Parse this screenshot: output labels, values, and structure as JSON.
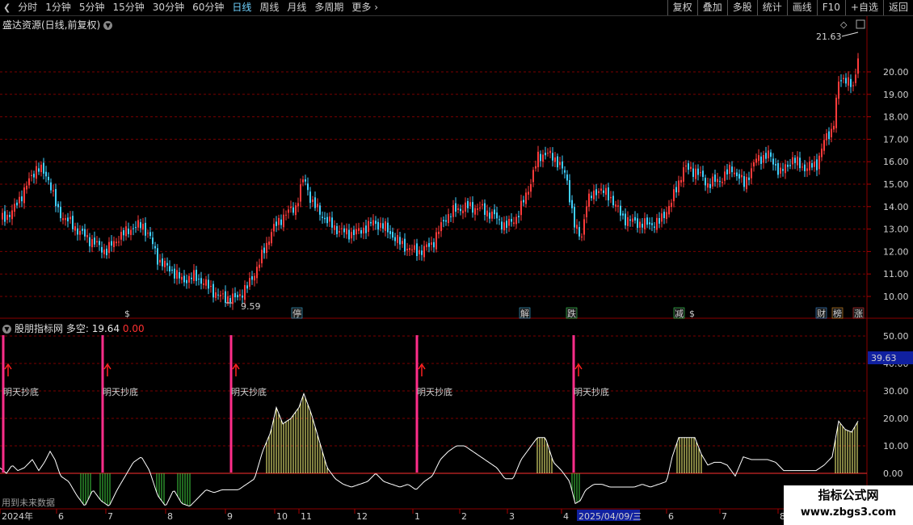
{
  "toolbar": {
    "periods": [
      "分时",
      "1分钟",
      "5分钟",
      "15分钟",
      "30分钟",
      "60分钟",
      "日线",
      "周线",
      "月线",
      "多周期",
      "更多"
    ],
    "active_period": "日线",
    "buttons": [
      "复权",
      "叠加",
      "多股",
      "统计",
      "画线",
      "F10",
      "+自选",
      "返回"
    ]
  },
  "main_chart": {
    "title": "盛达资源(日线,前复权)",
    "price_ticks": [
      "20.00",
      "19.00",
      "18.00",
      "17.00",
      "16.00",
      "15.00",
      "14.00",
      "13.00",
      "12.00",
      "11.00",
      "10.00"
    ],
    "max_label": "21.63",
    "min_label": "9.59",
    "event_marks": [
      {
        "label": "$",
        "color": "#ff3030"
      },
      {
        "label": "停",
        "color": "#40c8ff"
      },
      {
        "label": "解",
        "color": "#40c8ff"
      },
      {
        "label": "跌",
        "color": "#40ff60"
      },
      {
        "label": "减",
        "color": "#40ff60"
      },
      {
        "label": "$",
        "color": "#ff3030"
      },
      {
        "label": "财",
        "color": "#40a0ff"
      },
      {
        "label": "榜",
        "color": "#ffa020"
      },
      {
        "label": "涨",
        "color": "#ff3030"
      }
    ]
  },
  "indicator": {
    "name": "股朋指标网",
    "field": "多空:",
    "value1": "19.64",
    "value2": "0.00",
    "ticks": [
      "50.00",
      "40.00",
      "30.00",
      "20.00",
      "10.00",
      "0.00"
    ],
    "current_value": "39.63",
    "signal_label": "明天抄底",
    "signal_count": 5,
    "future_note": "用到未来数据"
  },
  "time_axis": {
    "labels": [
      "2024年",
      "6",
      "7",
      "8",
      "9",
      "10",
      "11",
      "12",
      "1",
      "2",
      "3",
      "4",
      "2025/04/09/三",
      "6",
      "7",
      "8"
    ]
  },
  "watermark": {
    "line1": "指标公式网",
    "line2": "www.zbgs3.com"
  },
  "colors": {
    "up": "#ff3b3b",
    "down": "#3fd0ff",
    "grid": "#7a0000",
    "signal": "#ff2e8a",
    "label_yellow": "#ffff40",
    "bar_yellow": "#ffff80",
    "bar_green": "#40d040"
  }
}
